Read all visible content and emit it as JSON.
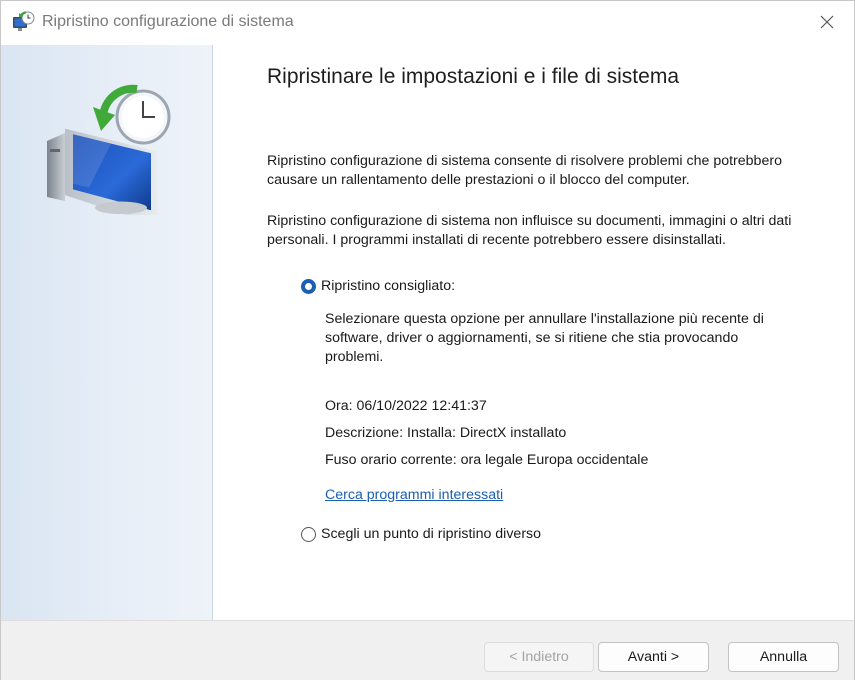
{
  "window": {
    "title": "Ripristino configurazione di sistema",
    "icon": "system-restore-icon",
    "close_icon": "close-icon"
  },
  "sidepanel": {
    "icon": "system-restore-monitor-clock-icon"
  },
  "main": {
    "heading": "Ripristinare le impostazioni e i file di sistema",
    "paragraph1": "Ripristino configurazione di sistema consente di risolvere problemi che potrebbero causare un rallentamento delle prestazioni o il blocco del computer.",
    "paragraph2": "Ripristino configurazione di sistema non influisce su documenti, immagini o altri dati personali. I programmi installati di recente potrebbero essere disinstallati.",
    "options": {
      "recommended": {
        "label": "Ripristino consigliato:",
        "selected": true,
        "description": "Selezionare questa opzione per annullare l'installazione più recente di software, driver o aggiornamenti, se si ritiene che stia provocando problemi.",
        "time": "Ora: 06/10/2022 12:41:37",
        "desc": "Descrizione: Installa: DirectX installato",
        "timezone": "Fuso orario corrente: ora legale Europa occidentale",
        "link": "Cerca programmi interessati"
      },
      "other": {
        "label": "Scegli un punto di ripristino diverso",
        "selected": false
      }
    }
  },
  "footer": {
    "back_label": "< Indietro",
    "back_enabled": false,
    "next_label": "Avanti >",
    "cancel_label": "Annulla"
  },
  "colors": {
    "accent": "#1a5fb4",
    "sidepanel": "#e3ebf5",
    "footer": "#f0f0f0"
  }
}
